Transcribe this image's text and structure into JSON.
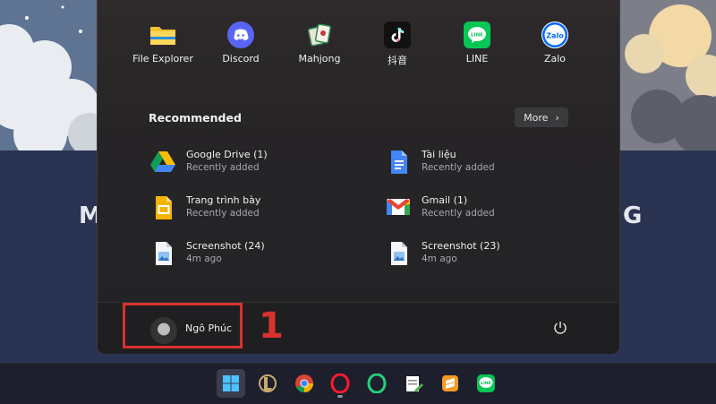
{
  "wallpaper": {
    "left_letter": "M",
    "right_letter": "G"
  },
  "pinned_apps": [
    {
      "label": "File Explorer",
      "icon": "folder-icon"
    },
    {
      "label": "Discord",
      "icon": "discord-icon"
    },
    {
      "label": "Mahjong",
      "icon": "mahjong-icon"
    },
    {
      "label": "抖音",
      "icon": "tiktok-icon"
    },
    {
      "label": "LINE",
      "icon": "line-icon"
    },
    {
      "label": "Zalo",
      "icon": "zalo-icon"
    }
  ],
  "recommended": {
    "title": "Recommended",
    "more_label": "More",
    "items": [
      {
        "name": "Google Drive (1)",
        "sub": "Recently added",
        "icon": "google-drive-icon"
      },
      {
        "name": "Tài liệu",
        "sub": "Recently added",
        "icon": "google-docs-icon"
      },
      {
        "name": "Trang trình bày",
        "sub": "Recently added",
        "icon": "google-slides-icon"
      },
      {
        "name": "Gmail (1)",
        "sub": "Recently added",
        "icon": "gmail-icon"
      },
      {
        "name": "Screenshot (24)",
        "sub": "4m ago",
        "icon": "image-file-icon"
      },
      {
        "name": "Screenshot (23)",
        "sub": "4m ago",
        "icon": "image-file-icon"
      }
    ]
  },
  "user": {
    "name": "Ngô Phúc"
  },
  "annotation": {
    "step": "1"
  },
  "colors": {
    "highlight": "#d8322e",
    "menu_bg": "#262426",
    "taskbar_bg": "#1d1f2c"
  },
  "taskbar": [
    "windows-start-icon",
    "league-of-legends-icon",
    "chrome-icon",
    "opera-icon",
    "opera-gx-icon",
    "notepad-icon",
    "sublime-icon",
    "line-icon"
  ]
}
